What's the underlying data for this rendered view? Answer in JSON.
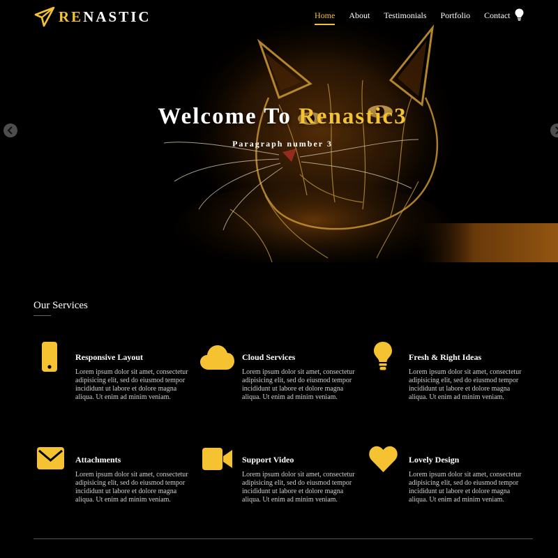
{
  "brand": {
    "logo_accent": "RE",
    "logo_rest": "NASTIC",
    "accent_color": "#f5c232"
  },
  "nav": {
    "items": [
      {
        "label": "Home",
        "active": true
      },
      {
        "label": "About",
        "active": false
      },
      {
        "label": "Testimonials",
        "active": false
      },
      {
        "label": "Portfolio",
        "active": false
      },
      {
        "label": "Contact",
        "active": false
      }
    ],
    "theme_toggle_icon": "lightbulb-icon"
  },
  "hero": {
    "title_prefix": "Welcome To ",
    "title_highlight": "Renastic3",
    "subtitle": "Paragraph number 3",
    "prev_icon": "chevron-left-icon",
    "next_icon": "chevron-right-icon"
  },
  "services": {
    "heading": "Our Services",
    "items": [
      {
        "icon": "mobile-phone-icon",
        "title": "Responsive Layout",
        "text": "Lorem ipsum dolor sit amet, consectetur adipisicing elit, sed do eiusmod tempor incididunt ut labore et dolore magna aliqua. Ut enim ad minim veniam."
      },
      {
        "icon": "cloud-icon",
        "title": "Cloud Services",
        "text": "Lorem ipsum dolor sit amet, consectetur adipisicing elit, sed do eiusmod tempor incididunt ut labore et dolore magna aliqua. Ut enim ad minim veniam."
      },
      {
        "icon": "lightbulb-icon",
        "title": "Fresh & Right Ideas",
        "text": "Lorem ipsum dolor sit amet, consectetur adipisicing elit, sed do eiusmod tempor incididunt ut labore et dolore magna aliqua. Ut enim ad minim veniam."
      },
      {
        "icon": "envelope-icon",
        "title": "Attachments",
        "text": "Lorem ipsum dolor sit amet, consectetur adipisicing elit, sed do eiusmod tempor incididunt ut labore et dolore magna aliqua. Ut enim ad minim veniam."
      },
      {
        "icon": "video-camera-icon",
        "title": "Support Video",
        "text": "Lorem ipsum dolor sit amet, consectetur adipisicing elit, sed do eiusmod tempor incididunt ut labore et dolore magna aliqua. Ut enim ad minim veniam."
      },
      {
        "icon": "heart-icon",
        "title": "Lovely Design",
        "text": "Lorem ipsum dolor sit amet, consectetur adipisicing elit, sed do eiusmod tempor incididunt ut labore et dolore magna aliqua. Ut enim ad minim veniam."
      }
    ]
  }
}
